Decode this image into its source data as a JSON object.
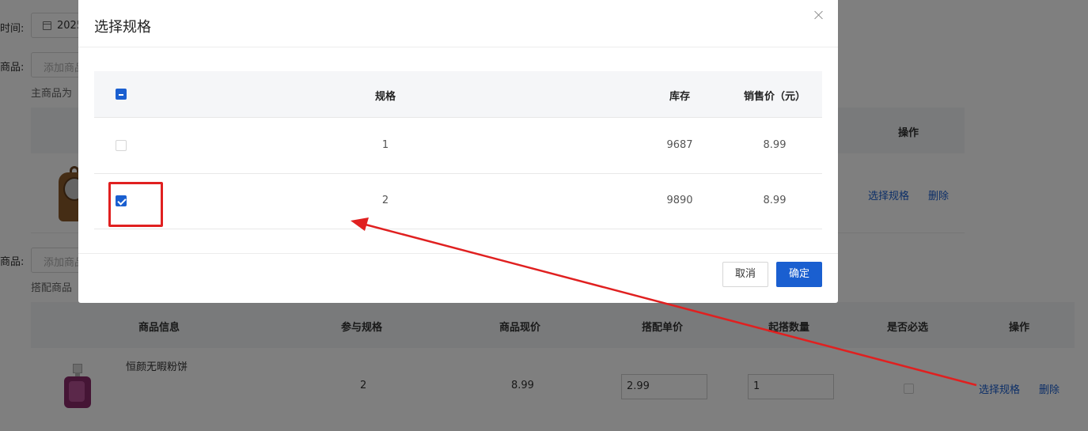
{
  "page": {
    "time_label": "时间:",
    "date_value": "2025",
    "main_product_label": "商品:",
    "main_add_placeholder": "添加商品",
    "main_hint": "主商品为",
    "op_header": "操作",
    "select_spec_link": "选择规格",
    "delete_link": "删除",
    "combo_product_label": "商品:",
    "combo_add_placeholder": "添加商品",
    "combo_hint": "搭配商品",
    "combo_table": {
      "headers": [
        "商品信息",
        "参与规格",
        "商品现价",
        "搭配单价",
        "起搭数量",
        "是否必选",
        "操作"
      ],
      "rows": [
        {
          "name": "恒颜无暇粉饼",
          "spec": "2",
          "price": "8.99",
          "combo_price": "2.99",
          "min_qty": "1",
          "select_spec": "选择规格",
          "delete": "删除"
        }
      ]
    }
  },
  "dialog": {
    "title": "选择规格",
    "headers": {
      "spec": "规格",
      "stock": "库存",
      "price": "销售价（元）"
    },
    "rows": [
      {
        "spec": "1",
        "stock": "9687",
        "price": "8.99",
        "checked": false
      },
      {
        "spec": "2",
        "stock": "9890",
        "price": "8.99",
        "checked": true
      }
    ],
    "cancel_label": "取消",
    "confirm_label": "确定"
  },
  "colors": {
    "accent": "#1a5fd0",
    "annotation": "#e02020"
  }
}
